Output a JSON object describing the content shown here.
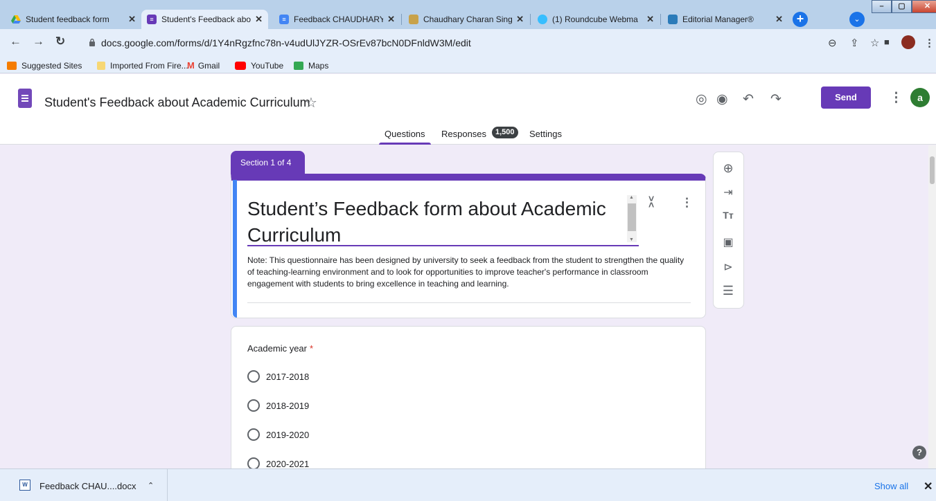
{
  "browser": {
    "tabs": [
      {
        "title": "Student feedback form",
        "icon": "google-drive-icon",
        "color": "#fbbc04"
      },
      {
        "title": "Student's Feedback abo",
        "icon": "google-forms-icon",
        "color": "#673ab7"
      },
      {
        "title": "Feedback CHAUDHARY",
        "icon": "google-docs-icon",
        "color": "#4285f4"
      },
      {
        "title": "Chaudhary Charan Sing",
        "icon": "university-logo-icon",
        "color": "#c8a24a"
      },
      {
        "title": "(1) Roundcube Webma",
        "icon": "roundcube-icon",
        "color": "#37beff"
      },
      {
        "title": "Editorial Manager®",
        "icon": "editorial-manager-icon",
        "color": "#2b7bb9"
      }
    ],
    "url": "docs.google.com/forms/d/1Y4nRgzfnc78n-v4udUlJYZR-OSrEv87bcN0DFnldW3M/edit",
    "bookmarks": [
      {
        "label": "Suggested Sites",
        "color": "#f57c00"
      },
      {
        "label": "Imported From Fire...",
        "color": "#f7d774"
      },
      {
        "label": "Gmail",
        "color": "#ea4335"
      },
      {
        "label": "YouTube",
        "color": "#ff0000"
      },
      {
        "label": "Maps",
        "color": "#34a853"
      }
    ]
  },
  "app": {
    "title": "Student's Feedback about Academic Curriculum",
    "send_label": "Send",
    "avatar_letter": "a",
    "tabs": {
      "questions": "Questions",
      "responses": "Responses",
      "settings": "Settings"
    },
    "responses_count": "1,500",
    "accent_color": "#673ab7"
  },
  "form": {
    "section_label": "Section 1 of 4",
    "title": "Student’s Feedback form about Academic Curriculum",
    "description": "Note: This questionnaire has been designed by university to seek a feedback from the student to strengthen the quality of teaching-learning environment and to look for opportunities to improve teacher's performance in classroom engagement with students to bring excellence in teaching and learning.",
    "question": {
      "label": "Academic year",
      "required_mark": "*",
      "options": [
        "2017-2018",
        "2018-2019",
        "2019-2020",
        "2020-2021"
      ]
    }
  },
  "downloads": {
    "file": "Feedback CHAU....docx",
    "show_all": "Show all"
  }
}
